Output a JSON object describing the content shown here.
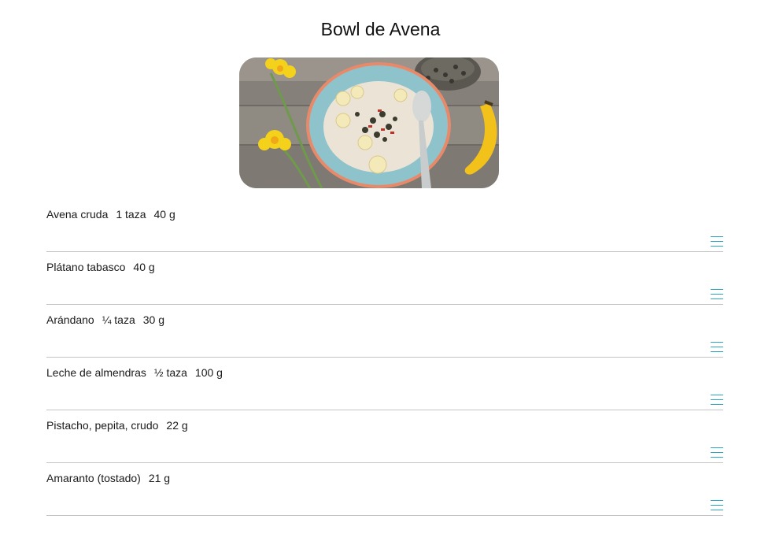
{
  "title": "Bowl de Avena",
  "image": {
    "icon": "oat-bowl-photo",
    "alt": ""
  },
  "colors": {
    "accent": "#2ea5c0",
    "divider": "#c4c4c4"
  },
  "ingredients": [
    {
      "name": "Avena cruda",
      "quantity": "1 taza",
      "weight": "40 g"
    },
    {
      "name": "Plátano tabasco",
      "quantity": "",
      "weight": "40 g"
    },
    {
      "name": "Arándano",
      "quantity": "¼ taza",
      "weight": "30 g"
    },
    {
      "name": "Leche de almendras",
      "quantity": "½ taza",
      "weight": "100 g"
    },
    {
      "name": "Pistacho, pepita, crudo",
      "quantity": "",
      "weight": "22 g"
    },
    {
      "name": "Amaranto (tostado)",
      "quantity": "",
      "weight": "21 g"
    }
  ]
}
